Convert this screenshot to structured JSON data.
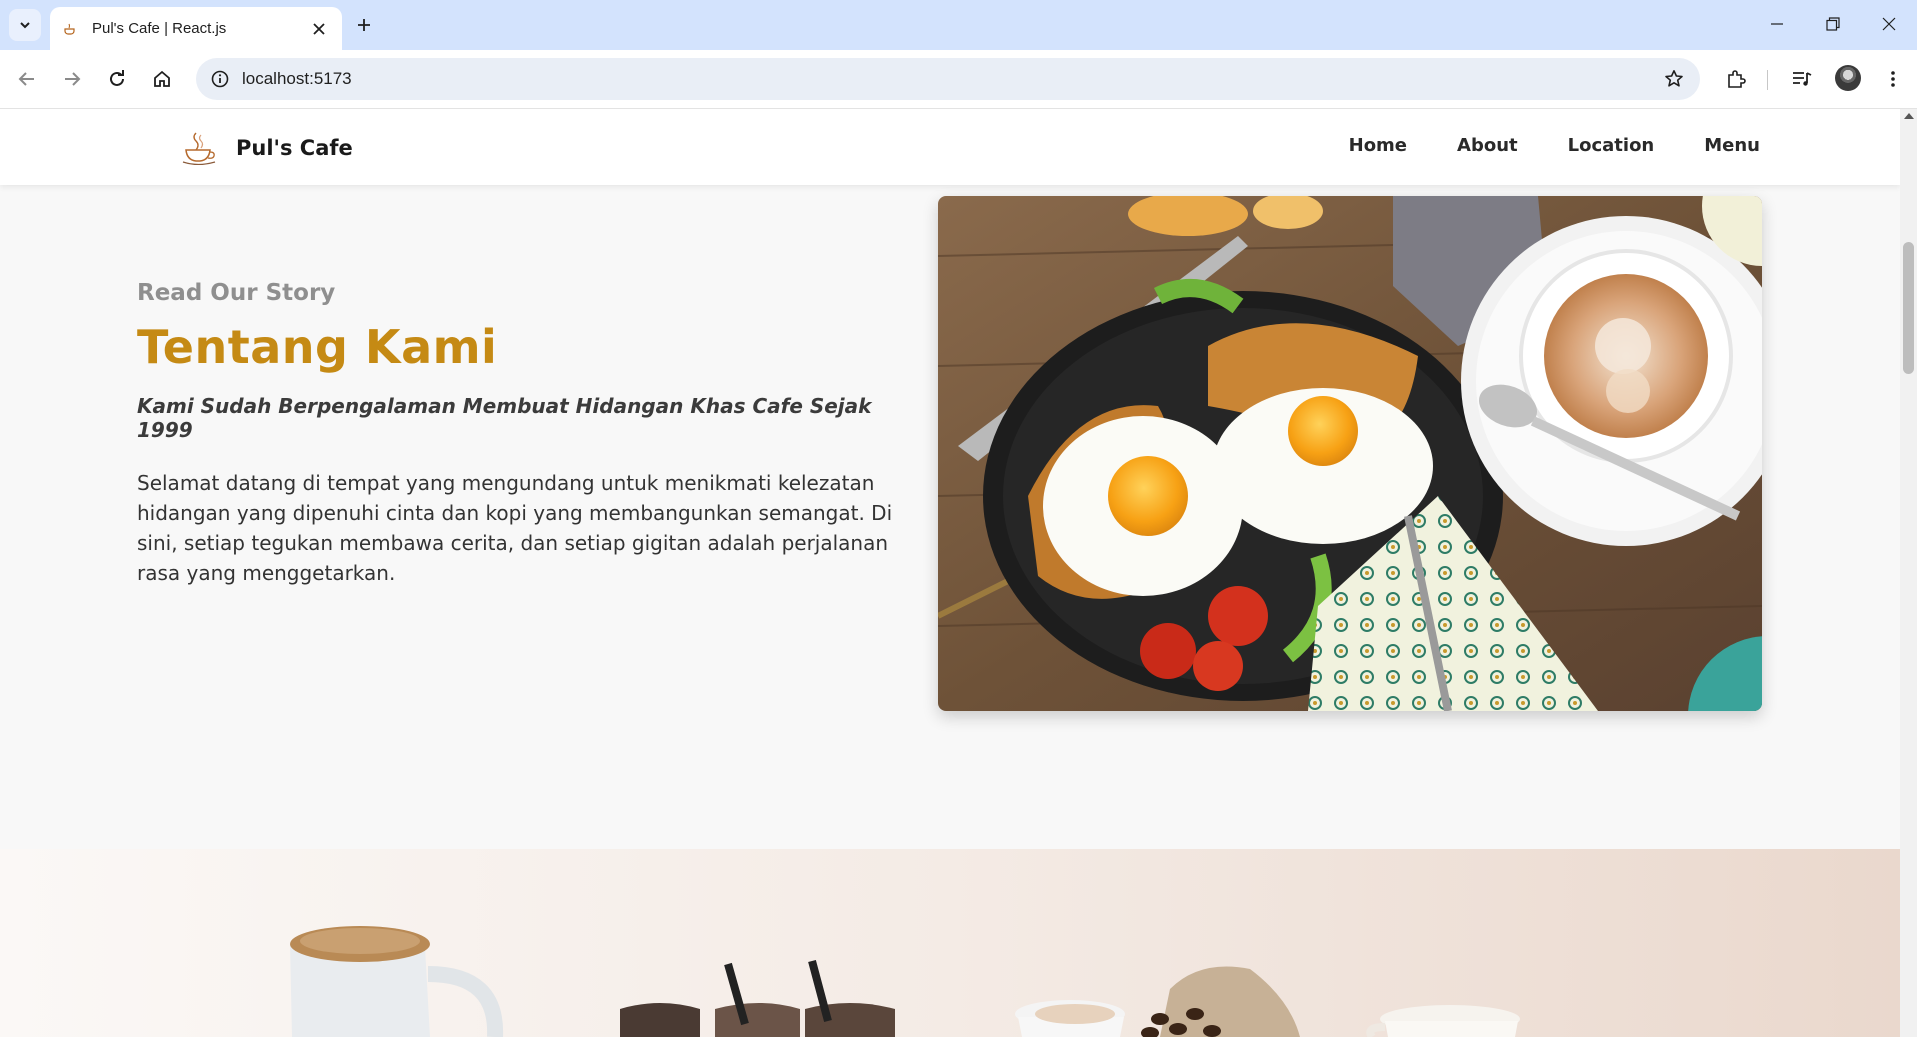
{
  "browser": {
    "tab_title": "Pul's Cafe | React.js",
    "url": "localhost:5173"
  },
  "site": {
    "brand_name": "Pul's Cafe",
    "nav": [
      "Home",
      "About",
      "Location",
      "Menu"
    ]
  },
  "about": {
    "eyebrow": "Read Our Story",
    "heading": "Tentang Kami",
    "tagline": "Kami Sudah Berpengalaman Membuat Hidangan Khas Cafe Sejak 1999",
    "body": "Selamat datang di tempat yang mengundang untuk menikmati kelezatan hidangan yang dipenuhi cinta dan kopi yang membangunkan semangat. Di sini, setiap tegukan membawa cerita, dan setiap gigitan adalah perjalanan rasa yang menggetarkan."
  },
  "colors": {
    "accent": "#c58a14",
    "browser_tabbar": "#d3e3fd"
  }
}
